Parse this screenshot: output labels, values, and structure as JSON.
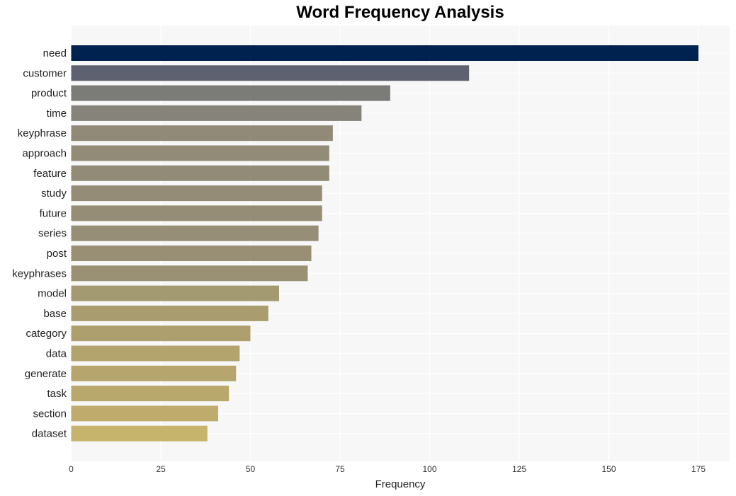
{
  "chart_data": {
    "type": "bar",
    "orientation": "horizontal",
    "title": "Word Frequency Analysis",
    "xlabel": "Frequency",
    "ylabel": "",
    "xlim": [
      0,
      183.5
    ],
    "xticks": [
      0,
      25,
      50,
      75,
      100,
      125,
      150,
      175
    ],
    "grid": true,
    "legend": "none",
    "colormap": "cividis",
    "categories": [
      "need",
      "customer",
      "product",
      "time",
      "keyphrase",
      "approach",
      "feature",
      "study",
      "future",
      "series",
      "post",
      "keyphrases",
      "model",
      "base",
      "category",
      "data",
      "generate",
      "task",
      "section",
      "dataset"
    ],
    "values": [
      175,
      111,
      89,
      81,
      73,
      72,
      72,
      70,
      70,
      69,
      67,
      66,
      58,
      55,
      50,
      47,
      46,
      44,
      41,
      38
    ],
    "colors": [
      "#00224e",
      "#5e6270",
      "#7b7b78",
      "#86837a",
      "#918a78",
      "#928b78",
      "#928b78",
      "#948c77",
      "#958d76",
      "#968e76",
      "#988f75",
      "#9a9174",
      "#a49a71",
      "#a99d6f",
      "#ae9f6e",
      "#b3a46d",
      "#b6a66d",
      "#b9a86c",
      "#bfac6c",
      "#c6b46c"
    ]
  }
}
